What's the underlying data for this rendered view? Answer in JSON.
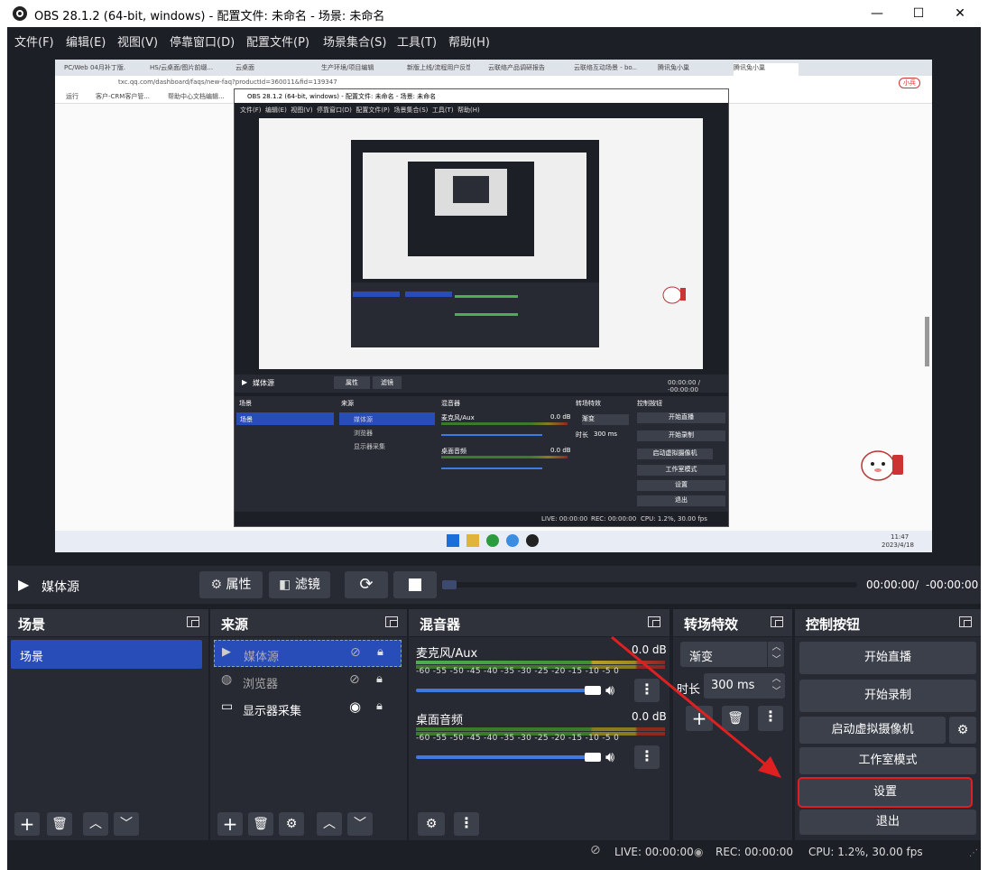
{
  "window": {
    "title": "OBS 28.1.2 (64-bit, windows) - 配置文件: 未命名 - 场景: 未命名",
    "minimize": "—",
    "maximize": "☐",
    "close": "✕"
  },
  "menu": [
    "文件(F)",
    "编辑(E)",
    "视图(V)",
    "停靠窗口(D)",
    "配置文件(P)",
    "场景集合(S)",
    "工具(T)",
    "帮助(H)"
  ],
  "browser": {
    "tabs": [
      "PC/Web 04月补丁版...",
      "HS/云桌面/图片前缀...",
      "云桌面",
      "生产环境/项目编辑",
      "新版上线/流程用户反馈",
      "云联络产品调研报告",
      "云联络互动场景 - bo...",
      "腾讯兔小巢",
      "腾讯兔小巢"
    ],
    "url": "txc.qq.com/dashboard/faqs/new-faq?productId=360011&fid=139347",
    "bookmarks": [
      "运行",
      "客户-CRM客户管...",
      "帮助中心文档编辑..."
    ],
    "profile_badge": "小兵",
    "taskbar_time": "11:47",
    "taskbar_date": "2023/4/18"
  },
  "inner_obs": {
    "title": "OBS 28.1.2 (64-bit, windows) - 配置文件: 未命名 - 场景: 未命名",
    "menu": [
      "文件(F)",
      "编辑(E)",
      "视图(V)",
      "停靠窗口(D)",
      "配置文件(P)",
      "场景集合(S)",
      "工具(T)",
      "帮助(H)"
    ],
    "source_name": "媒体源",
    "properties": "属性",
    "filters": "滤镜",
    "time": "00:00:00 / -00:00:00",
    "docks": [
      "场景",
      "来源",
      "混音器",
      "转场特效",
      "控制按钮"
    ],
    "scene": "场景",
    "sources": [
      "媒体源",
      "浏览器",
      "显示器采集"
    ],
    "mixer": [
      {
        "name": "麦克风/Aux",
        "db": "0.0 dB"
      },
      {
        "name": "桌面音频",
        "db": "0.0 dB"
      }
    ],
    "transition": "渐变",
    "duration_label": "时长",
    "duration": "300 ms",
    "controls": [
      "开始直播",
      "开始录制",
      "启动虚拟摄像机",
      "工作室模式",
      "设置",
      "退出"
    ],
    "live": "LIVE: 00:00:00",
    "rec": "REC: 00:00:00",
    "cpu": "CPU: 1.2%, 30.00 fps"
  },
  "media": {
    "source_name": "媒体源",
    "properties": "属性",
    "filters": "滤镜",
    "time": "00:00:00",
    "sep": "/",
    "remaining": "-00:00:00"
  },
  "scenes": {
    "title": "场景",
    "items": [
      "场景"
    ]
  },
  "sources": {
    "title": "来源",
    "items": [
      {
        "name": "媒体源",
        "visible": false,
        "selected": true
      },
      {
        "name": "浏览器",
        "visible": false,
        "selected": false
      },
      {
        "name": "显示器采集",
        "visible": true,
        "selected": false
      }
    ]
  },
  "mixer": {
    "title": "混音器",
    "channels": [
      {
        "name": "麦克风/Aux",
        "db": "0.0 dB",
        "volume": 1.0
      },
      {
        "name": "桌面音频",
        "db": "0.0 dB",
        "volume": 1.0
      }
    ],
    "scale": "-60 -55 -50 -45 -40 -35 -30 -25 -20 -15 -10 -5  0"
  },
  "transitions": {
    "title": "转场特效",
    "selected": "渐变",
    "duration_label": "时长",
    "duration": "300 ms"
  },
  "controls": {
    "title": "控制按钮",
    "start_stream": "开始直播",
    "start_record": "开始录制",
    "virtual_cam": "启动虚拟摄像机",
    "studio_mode": "工作室模式",
    "settings": "设置",
    "exit": "退出"
  },
  "status": {
    "live": "LIVE: 00:00:00",
    "rec": "REC: 00:00:00",
    "cpu": "CPU: 1.2%, 30.00 fps"
  },
  "colors": {
    "accent": "#284cb8",
    "highlight": "#e02020",
    "panel": "#272a33",
    "background": "#1d1f26"
  }
}
